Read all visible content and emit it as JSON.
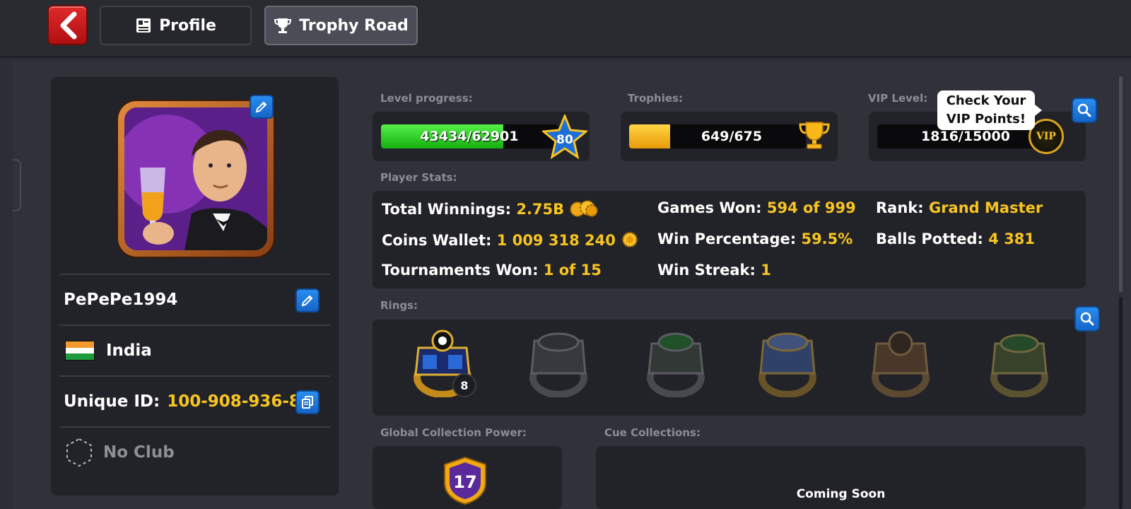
{
  "tabs": {
    "profile_label": "Profile",
    "trophy_road_label": "Trophy Road"
  },
  "profile": {
    "username": "PePePe1994",
    "country": "India",
    "unique_id_label": "Unique ID:",
    "unique_id": "100-908-936-8",
    "club": "No Club"
  },
  "level": {
    "label": "Level progress:",
    "progress_text": "43434/62901",
    "current": 43434,
    "max": 62901,
    "badge_level": "80",
    "bar_color": "#2fd42a"
  },
  "trophies": {
    "label": "Trophies:",
    "progress_text": "649/675",
    "current": 649,
    "max": 675,
    "fill_fraction": 0.23,
    "bar_color": "#f5b20c"
  },
  "vip": {
    "label": "VIP Level:",
    "progress_text": "1816/15000",
    "tooltip_line1": "Check Your",
    "tooltip_line2": "VIP Points!",
    "badge_text": "VIP"
  },
  "player_stats": {
    "label": "Player Stats:",
    "total_winnings_label": "Total Winnings:",
    "total_winnings": "2.75B",
    "coins_wallet_label": "Coins Wallet:",
    "coins_wallet": "1 009 318 240",
    "tournaments_won_label": "Tournaments Won:",
    "tournaments_won": "1 of 15",
    "games_won_label": "Games Won:",
    "games_won": "594 of 999",
    "win_percentage_label": "Win Percentage:",
    "win_percentage": "59.5%",
    "win_streak_label": "Win Streak:",
    "win_streak": "1",
    "rank_label": "Rank:",
    "rank": "Grand Master",
    "balls_potted_label": "Balls Potted:",
    "balls_potted": "4 381"
  },
  "rings": {
    "label": "Rings:",
    "first_ring_count": "8"
  },
  "collection": {
    "global_power_label": "Global Collection Power:",
    "global_power_value": "17",
    "cue_collections_label": "Cue Collections:",
    "coming_soon": "Coming Soon"
  },
  "colors": {
    "accent_gold": "#f7c422",
    "button_blue": "#1f7ae0",
    "back_red": "#d41e1e"
  }
}
